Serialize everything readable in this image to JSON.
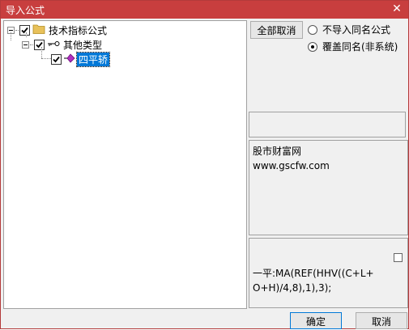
{
  "window": {
    "title": "导入公式"
  },
  "tree": {
    "root_label": "技术指标公式",
    "child_label": "其他类型",
    "leaf_label": "四平轿"
  },
  "options": {
    "select_all_label": "全部取消",
    "radio_skip_label": "不导入同名公式",
    "radio_overwrite_label": "覆盖同名(非系统)",
    "selected": "overwrite"
  },
  "description": {
    "line1": "股市财富网",
    "line2": "www.gscfw.com"
  },
  "formula": {
    "text": "一平:MA(REF(HHV((C+L+O+H)/4,8),1),3);"
  },
  "buttons": {
    "ok_label": "确定",
    "cancel_label": "取消"
  },
  "colors": {
    "titlebar": "#c83e3e",
    "selection": "#0078d7",
    "folder": "#e8c15a",
    "diamond": "#b030c0"
  }
}
